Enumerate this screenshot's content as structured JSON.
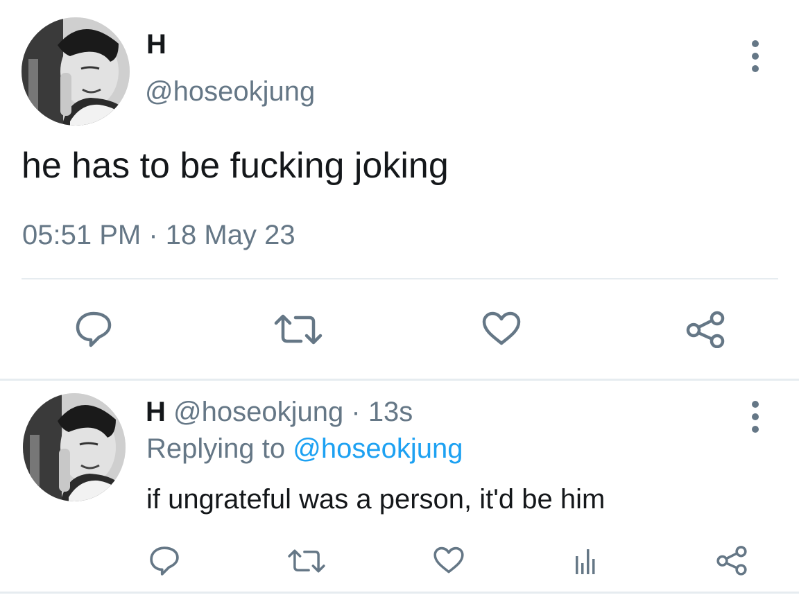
{
  "main_tweet": {
    "name": "H",
    "handle": "@hoseokjung",
    "text": "he has to be fucking joking",
    "time": "05:51 PM",
    "separator": "·",
    "date": "18 May 23",
    "actions": [
      "reply-icon",
      "retweet-icon",
      "like-icon",
      "share-icon"
    ]
  },
  "reply_tweet": {
    "name": "H",
    "handle": "@hoseokjung",
    "separator": "·",
    "time_ago": "13s",
    "replying_to_label": "Replying to",
    "replying_to_handle": "@hoseokjung",
    "text": "if ungrateful was a person, it'd be him",
    "actions": [
      "reply-icon",
      "retweet-icon",
      "like-icon",
      "analytics-icon",
      "share-icon"
    ]
  },
  "colors": {
    "text_primary": "#14171a",
    "text_secondary": "#657786",
    "link": "#1da1f2",
    "divider": "#e6ecf0",
    "icon": "#657786"
  }
}
